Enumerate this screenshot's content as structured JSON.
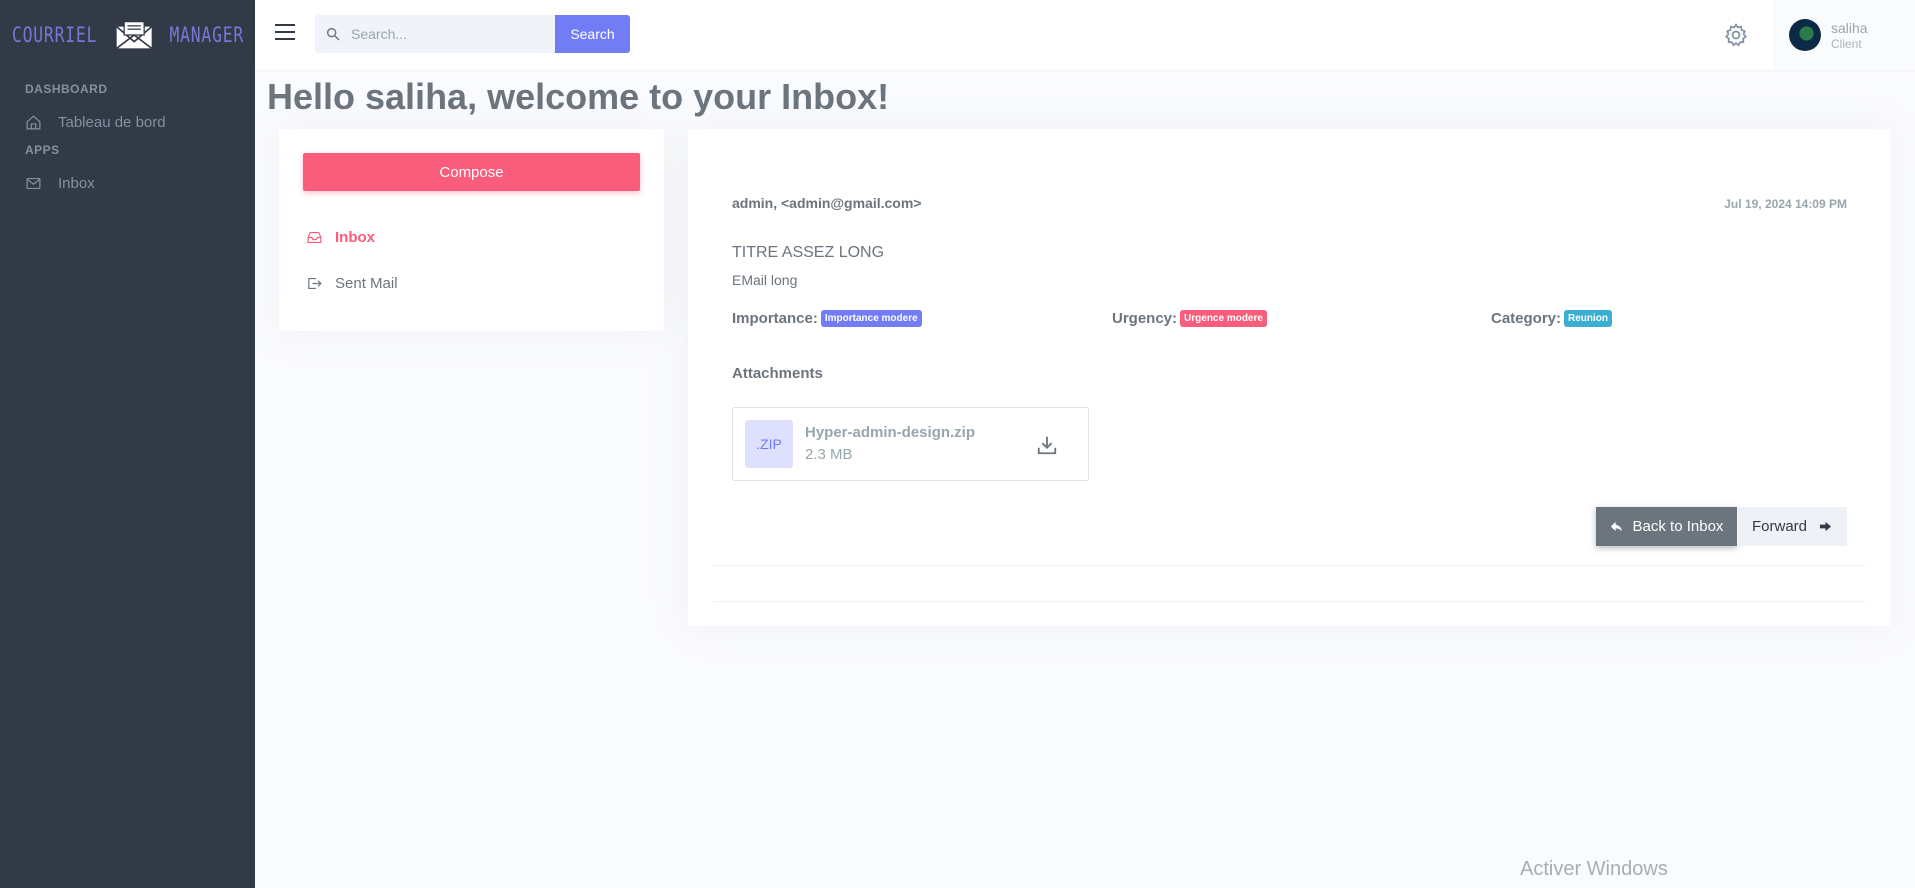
{
  "sidebar": {
    "logo": {
      "left": "COURRIEL",
      "right": "MANAGER"
    },
    "sections": [
      {
        "title": "DASHBOARD",
        "items": [
          {
            "label": "Tableau de bord",
            "icon": "home-icon"
          }
        ]
      },
      {
        "title": "APPS",
        "items": [
          {
            "label": "Inbox",
            "icon": "mail-icon"
          }
        ]
      }
    ]
  },
  "topbar": {
    "search_placeholder": "Search...",
    "search_button": "Search",
    "user": {
      "name": "saliha",
      "role": "Client"
    }
  },
  "page": {
    "title": "Hello saliha, welcome to your Inbox!"
  },
  "left_panel": {
    "compose_label": "Compose",
    "nav": [
      {
        "label": "Inbox",
        "icon": "inbox-icon",
        "active": true
      },
      {
        "label": "Sent Mail",
        "icon": "sent-icon",
        "active": false
      }
    ]
  },
  "mail": {
    "from": "admin, <admin@gmail.com>",
    "date": "Jul 19, 2024 14:09 PM",
    "subject": "TITRE ASSEZ LONG",
    "body": "EMail long",
    "importance_label": "Importance:",
    "importance_value": "Importance modere",
    "urgency_label": "Urgency:",
    "urgency_value": "Urgence modere",
    "category_label": "Category:",
    "category_value": "Reunion",
    "attachments_title": "Attachments",
    "attachment": {
      "ext": ".ZIP",
      "name": "Hyper-admin-design.zip",
      "size": "2.3 MB"
    },
    "back_label": "Back to Inbox",
    "forward_label": "Forward"
  },
  "colors": {
    "primary": "#727cf5",
    "danger": "#fa5c7c",
    "info": "#39afd1",
    "secondary": "#6c757d",
    "sidebar_bg": "#313a46"
  },
  "watermark": "Activer Windows"
}
